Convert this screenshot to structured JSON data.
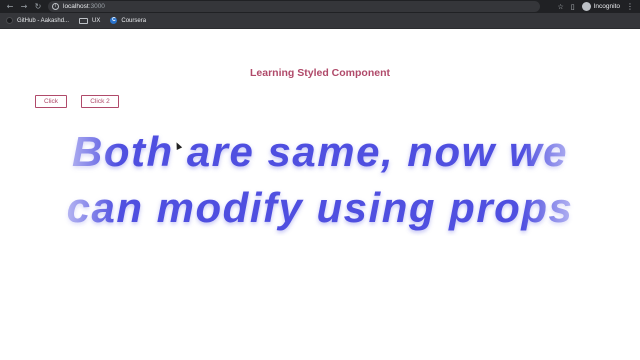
{
  "browser": {
    "url_host": "localhost",
    "url_port": ":3000",
    "incognito_label": "Incognito"
  },
  "bookmarks": [
    {
      "label": "GitHub - Aakashd..."
    },
    {
      "label": "UX"
    },
    {
      "label": "Coursera"
    }
  ],
  "page": {
    "heading": "Learning Styled Component",
    "button1_label": "Click",
    "button2_label": "Click 2",
    "big_text": "Both are same, now we can modify using props"
  },
  "colors": {
    "heading_accent": "#b04a6a",
    "big_text": "#4f4fe0",
    "browser_toolbar": "#202124",
    "bookmark_bar": "#35363a"
  }
}
